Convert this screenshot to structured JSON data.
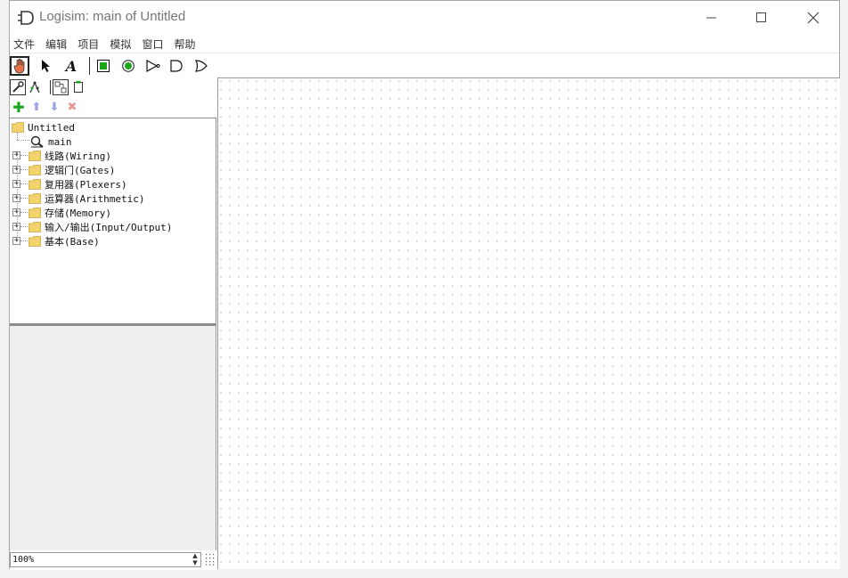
{
  "window": {
    "title": "Logisim: main of Untitled"
  },
  "menu": [
    "文件",
    "编辑",
    "项目",
    "模拟",
    "窗口",
    "帮助"
  ],
  "toolbar": {
    "tools": [
      {
        "name": "poke-tool",
        "icon": "hand-pointer-icon",
        "selected": true
      },
      {
        "name": "select-tool",
        "icon": "arrow-cursor-icon",
        "selected": false
      },
      {
        "name": "text-tool",
        "icon": "text-a-icon",
        "selected": false
      },
      {
        "name": "input-pin-tool",
        "icon": "input-pin-icon",
        "selected": false
      },
      {
        "name": "output-pin-tool",
        "icon": "output-pin-icon",
        "selected": false
      },
      {
        "name": "not-gate-tool",
        "icon": "not-gate-icon",
        "selected": false
      },
      {
        "name": "and-gate-tool",
        "icon": "and-gate-icon",
        "selected": false
      },
      {
        "name": "or-gate-tool",
        "icon": "or-gate-icon",
        "selected": false
      }
    ]
  },
  "tree": {
    "root": "Untitled",
    "circuit": "main",
    "libraries": [
      "线路(Wiring)",
      "逻辑门(Gates)",
      "复用器(Plexers)",
      "运算器(Arithmetic)",
      "存储(Memory)",
      "输入/输出(Input/Output)",
      "基本(Base)"
    ]
  },
  "zoom": {
    "value": "100%"
  },
  "colors": {
    "accent_green": "#1aa51a",
    "folder_yellow": "#f2d26b",
    "grid_dot": "#8a8a8a"
  }
}
